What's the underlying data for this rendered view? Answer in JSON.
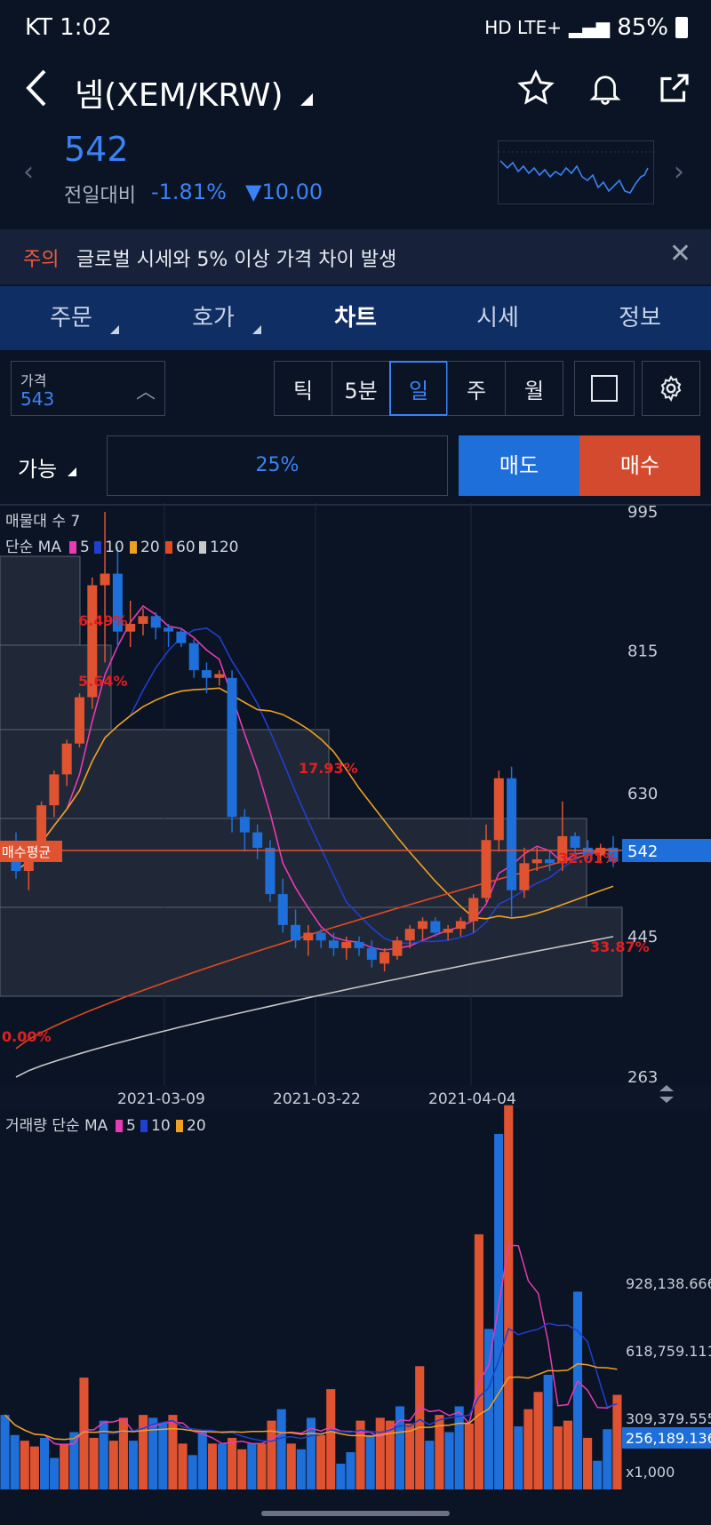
{
  "status": {
    "carrier_time": "KT 1:02",
    "network": "HD LTE+",
    "battery": "85%"
  },
  "header": {
    "title": "넴(XEM/KRW)"
  },
  "price": {
    "current": "542",
    "change_label": "전일대비",
    "change_pct": "-1.81%",
    "change_abs": "▼10.00"
  },
  "notice": {
    "tag": "주의",
    "message": "글로벌 시세와 5% 이상 가격 차이 발생"
  },
  "tabs": [
    "주문",
    "호가",
    "차트",
    "시세",
    "정보"
  ],
  "controls": {
    "price_label": "가격",
    "price_value": "543",
    "intervals": [
      "틱",
      "5분",
      "일",
      "주",
      "월"
    ],
    "active_interval": "일"
  },
  "order": {
    "available": "가능",
    "percent": "25%",
    "sell": "매도",
    "buy": "매수"
  },
  "colors": {
    "up": "#e05331",
    "down": "#1e6fd9",
    "accent": "#3b82f6",
    "bg": "#0b1424"
  },
  "chart_data": [
    {
      "type": "candlestick",
      "title": "매물대 수 7",
      "ma_legend": "단순 MA",
      "ma_periods": [
        "5",
        "10",
        "20",
        "60",
        "120"
      ],
      "ma_colors": [
        "#e83ab5",
        "#1f3fd0",
        "#f0a020",
        "#e04a20",
        "#c8c8c8"
      ],
      "y_ticks": [
        "995",
        "815",
        "630",
        "445",
        "263"
      ],
      "y_range": [
        263,
        995
      ],
      "x_ticks": [
        "2021-03-09",
        "2021-03-22",
        "2021-04-04"
      ],
      "current_price_tag": "542",
      "avg_tag": "매수평균",
      "annotations": [
        "5.64%",
        "17.93%",
        "32.01%",
        "33.87%",
        "0.00%"
      ],
      "candles": [
        {
          "o": 560,
          "h": 580,
          "l": 520,
          "c": 530
        },
        {
          "o": 530,
          "h": 560,
          "l": 505,
          "c": 555
        },
        {
          "o": 555,
          "h": 620,
          "l": 545,
          "c": 615
        },
        {
          "o": 615,
          "h": 660,
          "l": 600,
          "c": 655
        },
        {
          "o": 655,
          "h": 700,
          "l": 640,
          "c": 695
        },
        {
          "o": 695,
          "h": 760,
          "l": 690,
          "c": 755
        },
        {
          "o": 755,
          "h": 910,
          "l": 740,
          "c": 900
        },
        {
          "o": 900,
          "h": 995,
          "l": 800,
          "c": 915
        },
        {
          "o": 915,
          "h": 950,
          "l": 820,
          "c": 840
        },
        {
          "o": 840,
          "h": 880,
          "l": 820,
          "c": 850
        },
        {
          "o": 850,
          "h": 870,
          "l": 835,
          "c": 860
        },
        {
          "o": 860,
          "h": 865,
          "l": 830,
          "c": 845
        },
        {
          "o": 845,
          "h": 850,
          "l": 820,
          "c": 840
        },
        {
          "o": 840,
          "h": 845,
          "l": 820,
          "c": 825
        },
        {
          "o": 825,
          "h": 830,
          "l": 780,
          "c": 790
        },
        {
          "o": 790,
          "h": 800,
          "l": 760,
          "c": 780
        },
        {
          "o": 780,
          "h": 790,
          "l": 770,
          "c": 785
        },
        {
          "o": 780,
          "h": 790,
          "l": 580,
          "c": 600
        },
        {
          "o": 600,
          "h": 610,
          "l": 555,
          "c": 580
        },
        {
          "o": 580,
          "h": 590,
          "l": 545,
          "c": 560
        },
        {
          "o": 560,
          "h": 570,
          "l": 490,
          "c": 500
        },
        {
          "o": 500,
          "h": 520,
          "l": 450,
          "c": 460
        },
        {
          "o": 460,
          "h": 480,
          "l": 430,
          "c": 440
        },
        {
          "o": 440,
          "h": 460,
          "l": 420,
          "c": 450
        },
        {
          "o": 450,
          "h": 455,
          "l": 430,
          "c": 440
        },
        {
          "o": 440,
          "h": 450,
          "l": 420,
          "c": 430
        },
        {
          "o": 430,
          "h": 445,
          "l": 415,
          "c": 438
        },
        {
          "o": 438,
          "h": 445,
          "l": 420,
          "c": 430
        },
        {
          "o": 430,
          "h": 440,
          "l": 405,
          "c": 415
        },
        {
          "o": 410,
          "h": 430,
          "l": 400,
          "c": 425
        },
        {
          "o": 420,
          "h": 445,
          "l": 415,
          "c": 440
        },
        {
          "o": 440,
          "h": 460,
          "l": 430,
          "c": 455
        },
        {
          "o": 455,
          "h": 470,
          "l": 440,
          "c": 465
        },
        {
          "o": 465,
          "h": 470,
          "l": 445,
          "c": 450
        },
        {
          "o": 450,
          "h": 460,
          "l": 440,
          "c": 455
        },
        {
          "o": 455,
          "h": 470,
          "l": 445,
          "c": 465
        },
        {
          "o": 465,
          "h": 500,
          "l": 450,
          "c": 495
        },
        {
          "o": 495,
          "h": 590,
          "l": 490,
          "c": 570
        },
        {
          "o": 570,
          "h": 660,
          "l": 555,
          "c": 650
        },
        {
          "o": 650,
          "h": 665,
          "l": 470,
          "c": 505
        },
        {
          "o": 505,
          "h": 560,
          "l": 495,
          "c": 540
        },
        {
          "o": 540,
          "h": 560,
          "l": 530,
          "c": 545
        },
        {
          "o": 545,
          "h": 555,
          "l": 530,
          "c": 540
        },
        {
          "o": 540,
          "h": 620,
          "l": 530,
          "c": 575
        },
        {
          "o": 575,
          "h": 580,
          "l": 545,
          "c": 560
        },
        {
          "o": 560,
          "h": 570,
          "l": 545,
          "c": 550
        },
        {
          "o": 550,
          "h": 565,
          "l": 540,
          "c": 560
        },
        {
          "o": 560,
          "h": 575,
          "l": 535,
          "c": 542
        }
      ]
    },
    {
      "type": "bar",
      "title": "거래량 단순 MA",
      "ma_periods": [
        "5",
        "10",
        "20"
      ],
      "ma_colors": [
        "#e83ab5",
        "#1f3fd0",
        "#f0a020"
      ],
      "y_ticks": [
        "928,138.666",
        "618,759.111",
        "309,379.555"
      ],
      "current_tag": "256,189.136",
      "unit": "x1,000",
      "y_range": [
        0,
        1240000
      ],
      "volumes": [
        260,
        190,
        170,
        150,
        180,
        110,
        160,
        200,
        390,
        180,
        240,
        170,
        250,
        170,
        260,
        250,
        230,
        260,
        160,
        120,
        200,
        160,
        160,
        180,
        140,
        160,
        160,
        240,
        280,
        160,
        140,
        250,
        190,
        350,
        90,
        130,
        240,
        190,
        250,
        240,
        290,
        230,
        430,
        170,
        260,
        200,
        290,
        230,
        890,
        560,
        1240,
        1340,
        220,
        280,
        340,
        400,
        220,
        240,
        690,
        180,
        100,
        210,
        330
      ]
    }
  ]
}
